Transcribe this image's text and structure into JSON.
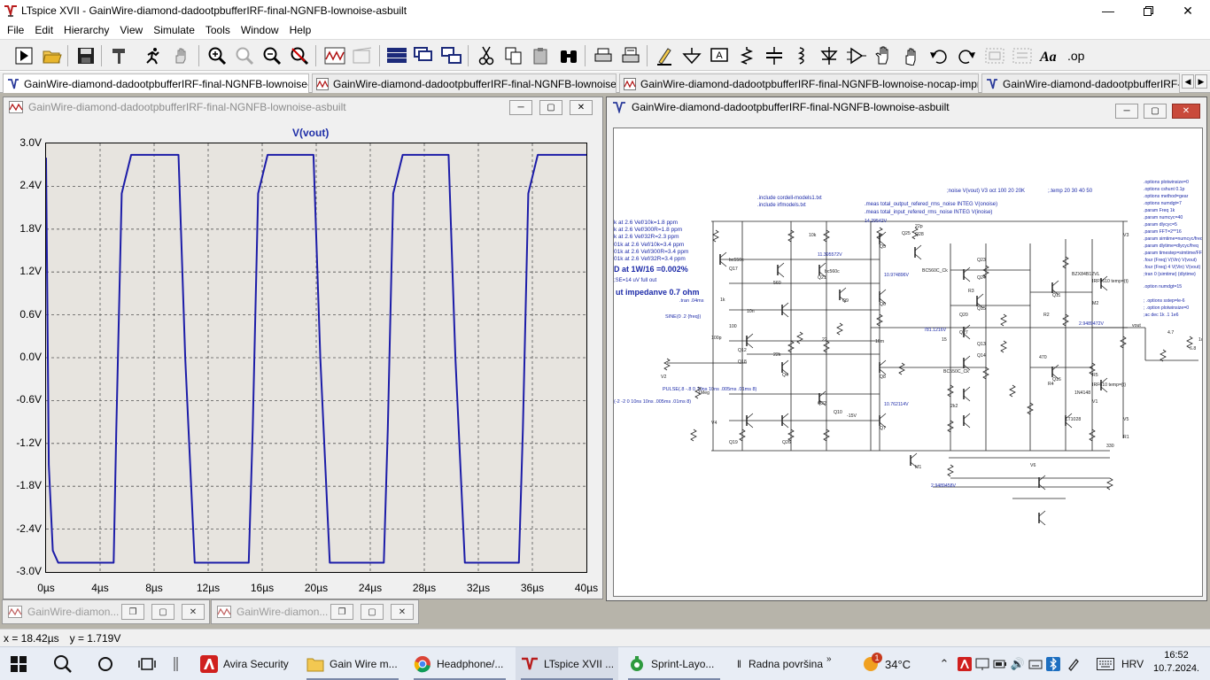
{
  "window": {
    "title": "LTspice XVII - GainWire-diamond-dadootpbufferIRF-final-NGNFB-lownoise-asbuilt",
    "icon": "ltspice-icon"
  },
  "menu": [
    "File",
    "Edit",
    "Hierarchy",
    "View",
    "Simulate",
    "Tools",
    "Window",
    "Help"
  ],
  "tabs": [
    {
      "label": "GainWire-diamond-dadootpbufferIRF-final-NGNFB-lownoise-asbuilt",
      "icon": "schematic-icon",
      "active": true
    },
    {
      "label": "GainWire-diamond-dadootpbufferIRF-final-NGNFB-lownoise-asbuilt",
      "icon": "waveform-icon",
      "active": false
    },
    {
      "label": "GainWire-diamond-dadootpbufferIRF-final-NGNFB-lownoise-nocap-improved SR",
      "icon": "waveform-icon",
      "active": false
    },
    {
      "label": "GainWire-diamond-dadootpbufferIRF-final-NGNFB-lowr",
      "icon": "schematic-icon",
      "active": false
    }
  ],
  "plot_window": {
    "title": "GainWire-diamond-dadootpbufferIRF-final-NGNFB-lownoise-asbuilt",
    "trace_label": "V(vout)"
  },
  "chart_data": {
    "type": "line",
    "title": "V(vout)",
    "xlabel": "",
    "ylabel": "",
    "x_ticks": [
      "0µs",
      "4µs",
      "8µs",
      "12µs",
      "16µs",
      "20µs",
      "24µs",
      "28µs",
      "32µs",
      "36µs",
      "40µs"
    ],
    "y_ticks": [
      "3.0V",
      "2.4V",
      "1.8V",
      "1.2V",
      "0.6V",
      "0.0V",
      "-0.6V",
      "-1.2V",
      "-1.8V",
      "-2.4V",
      "-3.0V"
    ],
    "xlim": [
      0,
      40
    ],
    "ylim": [
      -3.0,
      3.0
    ],
    "grid": true,
    "series": [
      {
        "name": "V(vout)",
        "color": "#1c1ca8",
        "x": [
          0,
          0.2,
          0.5,
          0.9,
          5.0,
          5.2,
          5.6,
          6.3,
          9.8,
          10.3,
          11.0,
          15.0,
          15.3,
          15.7,
          16.4,
          19.8,
          20.3,
          21.0,
          25.0,
          25.3,
          25.7,
          26.4,
          29.8,
          30.3,
          31.0,
          35.0,
          35.3,
          35.7,
          36.4,
          40.0
        ],
        "y": [
          2.8,
          -1.5,
          -2.7,
          -2.87,
          -2.87,
          -1.0,
          2.3,
          2.84,
          2.84,
          0.0,
          -2.87,
          -2.87,
          -1.0,
          2.3,
          2.84,
          2.84,
          0.0,
          -2.87,
          -2.87,
          -1.0,
          2.3,
          2.84,
          2.84,
          0.0,
          -2.87,
          -2.87,
          -1.0,
          2.3,
          2.84,
          2.84
        ]
      }
    ]
  },
  "schematic_window": {
    "title": "GainWire-diamond-dadootpbufferIRF-final-NGNFB-lownoise-asbuilt",
    "directives": [
      ".include cordell-models1.txt",
      ".include irfmodels.txt",
      ".meas total_output_refered_rms_noise INTEG V(onoise)",
      ".meas total_input_refered_rms_noise INTEG V(inoise)",
      ";noise V(vout) V3 oct 100 20 20K",
      ";.temp 20 30 40 50",
      "k at 2.6 Vef/10k=1.8 ppm",
      "k at 2.6 Vef/300R=1.8 ppm",
      "k at 2.6 Vef/32R=2.3 ppm",
      "01k at 2.6 Vef/10k=3.4 ppm",
      "01k at 2.6 Vef/300R=3.4 ppm",
      "01k at 2.6 Vef/32R=3.4 ppm",
      "D at 1W/16 =0.002%",
      "ut impedanve 0.7 ohm",
      ".tran .04ms",
      "SINE(0 .2 {freq})",
      "PULSE(.8 -.8 0 10ns 10ns .005ms .01ms 8)",
      "(-2 -2 0 10ns 10ns .005ms .01ms 8)",
      ".options plotwinsize=0",
      ".options cshunt 0.1p",
      ".options method=gear",
      ".options numdgt=7",
      ".param Freq 1k",
      ".param numcyc=40",
      ".param dlycyc=5",
      ".param FFT=2**16",
      ".param simtime=numcyc/freq",
      ".param dlytime=dlycyc/freq",
      ".param timestep=simtime/FFT",
      ".four {Freq} V(Vin) V(vout)",
      ".four {Freq} 4 V(Vin) V(vout)",
      ";tran 0 {simtime} {dlytime}",
      ".option numdgt=15",
      "; .options sstep=le-6",
      "; .option plotwinsize=0",
      ";ac dec 1k .1 1e6",
      ";SE=14 uV full out"
    ],
    "labels": [
      "14.29542V",
      "11.395572V",
      "10.974896V",
      "10.762114V",
      "2.9489472V",
      "2.9489458V",
      "-15V",
      "781.1216V",
      "bc550c",
      "bc560c",
      "BC560C_Ck",
      "BC550C_Ck",
      "IRF9610 temp={t}",
      "IRF610 temp={t}",
      "BZX84B12VL",
      "1N4148",
      "LT1028",
      "vout",
      "Q17",
      "Q21",
      "Q9",
      "Q5",
      "Q25",
      "Q6",
      "Q12",
      "Q18",
      "Q4",
      "Q22",
      "Q10",
      "Q8",
      "Q7",
      "Q19",
      "Q26",
      "Q23",
      "Q24",
      "Q13",
      "Q14",
      "Q11",
      "Q16",
      "Q20",
      "Q15",
      "Q27",
      "Q28",
      "M1",
      "M2",
      "V1",
      "V2",
      "V3",
      "V4",
      "V5",
      "V6",
      "R1",
      "R2",
      "R3",
      "R4",
      "R5",
      "10k",
      "1k",
      "470",
      "100",
      "22",
      "100p",
      "22p",
      "2k2",
      "10m",
      "1Meg",
      "15",
      "4.7",
      "6.8",
      "330",
      "560",
      "22k",
      "1u",
      "10n"
    ]
  },
  "minimized": [
    {
      "title": "GainWire-diamon...",
      "icon": "waveform-icon"
    },
    {
      "title": "GainWire-diamon...",
      "icon": "waveform-icon"
    }
  ],
  "status": {
    "x_readout": "x = 18.42µs",
    "y_readout": "y = 1.719V"
  },
  "taskbar": {
    "apps": [
      {
        "label": "Avira Security",
        "icon": "avira-icon"
      },
      {
        "label": "Gain Wire m...",
        "icon": "folder-icon"
      },
      {
        "label": "Headphone/...",
        "icon": "chrome-icon"
      },
      {
        "label": "LTspice XVII ...",
        "icon": "ltspice-icon"
      },
      {
        "label": "Sprint-Layo...",
        "icon": "sprint-icon"
      },
      {
        "label": "Radna površina",
        "icon": "desktop-icon"
      }
    ],
    "temperature": "34°C",
    "weather_badge": "1",
    "language": "HRV",
    "time": "16:52",
    "date": "10.7.2024."
  }
}
